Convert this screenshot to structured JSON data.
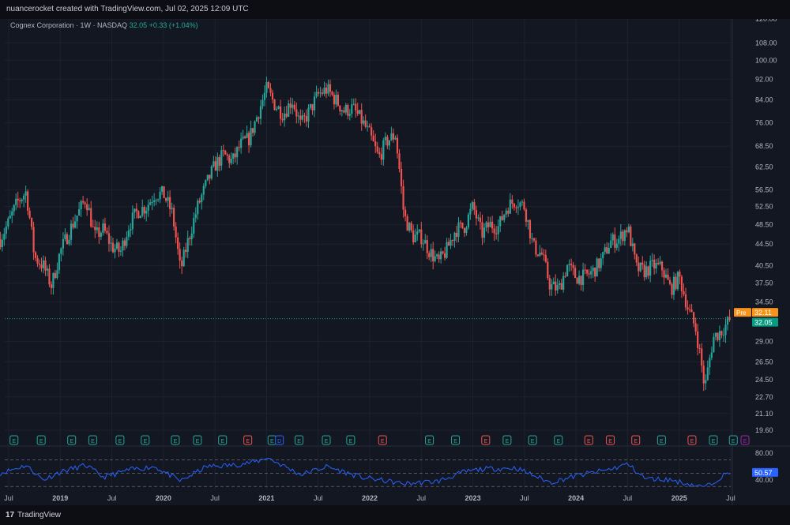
{
  "attribution": "nuancerocket created with TradingView.com, Jul 02, 2025 12:09 UTC",
  "legend": {
    "symbol": "Cognex Corporation · 1W · NASDAQ",
    "price": "32.05",
    "change": "+0.33 (+1.04%)"
  },
  "branding": "TradingView",
  "colors": {
    "up": "#26a69a",
    "down": "#ef5350",
    "rsi": "#2962ff",
    "pre": "#f7931a",
    "last": "#089981",
    "background": "#131722"
  },
  "chart_data": [
    {
      "type": "candlestick",
      "scale": "log",
      "y_ticks": [
        120.0,
        108.0,
        100.0,
        92.0,
        84.0,
        76.0,
        68.5,
        62.5,
        56.5,
        52.5,
        48.5,
        44.5,
        40.5,
        37.5,
        34.5,
        32.11,
        32.05,
        29.0,
        26.5,
        24.5,
        22.7,
        21.1,
        19.6
      ],
      "y_tick_labels": [
        "120.00",
        "108.00",
        "100.00",
        "92.00",
        "84.00",
        "76.00",
        "68.50",
        "62.50",
        "56.50",
        "52.50",
        "48.50",
        "44.50",
        "40.50",
        "37.50",
        "34.50",
        "32.11",
        "32.05",
        "29.00",
        "26.50",
        "24.50",
        "22.70",
        "21.10",
        "19.60"
      ],
      "x_tick_labels": [
        "Jul",
        "2019",
        "Jul",
        "2020",
        "Jul",
        "2021",
        "Jul",
        "2022",
        "Jul",
        "2023",
        "Jul",
        "2024",
        "Jul",
        "2025",
        "Jul"
      ],
      "x_tick_dates": [
        "2018-07-01",
        "2019-01-01",
        "2019-07-01",
        "2020-01-01",
        "2020-07-01",
        "2021-01-01",
        "2021-07-01",
        "2022-01-01",
        "2022-07-01",
        "2023-01-01",
        "2023-07-01",
        "2024-01-01",
        "2024-07-01",
        "2025-01-01",
        "2025-07-01"
      ],
      "last_price": 32.05,
      "pre_market": {
        "label": "Pre",
        "value": "32.11"
      },
      "last_label": "32.05",
      "price_path": [
        [
          "2018-06-01",
          45.5
        ],
        [
          "2018-07-01",
          49.0
        ],
        [
          "2018-08-01",
          53.5
        ],
        [
          "2018-09-01",
          56.0
        ],
        [
          "2018-10-01",
          42.0
        ],
        [
          "2018-11-01",
          40.5
        ],
        [
          "2018-12-01",
          37.0
        ],
        [
          "2019-01-01",
          43.0
        ],
        [
          "2019-02-01",
          47.0
        ],
        [
          "2019-03-01",
          50.5
        ],
        [
          "2019-04-01",
          54.5
        ],
        [
          "2019-05-01",
          46.0
        ],
        [
          "2019-06-01",
          47.5
        ],
        [
          "2019-07-01",
          44.0
        ],
        [
          "2019-08-01",
          43.0
        ],
        [
          "2019-09-01",
          48.5
        ],
        [
          "2019-10-01",
          51.5
        ],
        [
          "2019-11-01",
          52.5
        ],
        [
          "2019-12-01",
          55.5
        ],
        [
          "2020-01-01",
          55.5
        ],
        [
          "2020-02-01",
          51.0
        ],
        [
          "2020-03-01",
          39.5
        ],
        [
          "2020-04-01",
          46.0
        ],
        [
          "2020-05-01",
          52.5
        ],
        [
          "2020-06-01",
          58.0
        ],
        [
          "2020-07-01",
          63.0
        ],
        [
          "2020-08-01",
          66.0
        ],
        [
          "2020-09-01",
          64.0
        ],
        [
          "2020-10-01",
          69.0
        ],
        [
          "2020-11-01",
          71.0
        ],
        [
          "2020-12-01",
          79.0
        ],
        [
          "2021-01-01",
          88.0
        ],
        [
          "2021-02-01",
          82.0
        ],
        [
          "2021-03-01",
          79.0
        ],
        [
          "2021-04-01",
          84.0
        ],
        [
          "2021-05-01",
          75.0
        ],
        [
          "2021-06-01",
          80.0
        ],
        [
          "2021-07-01",
          86.0
        ],
        [
          "2021-08-01",
          88.0
        ],
        [
          "2021-09-01",
          84.0
        ],
        [
          "2021-10-01",
          80.0
        ],
        [
          "2021-11-01",
          81.0
        ],
        [
          "2021-12-01",
          77.0
        ],
        [
          "2022-01-01",
          72.0
        ],
        [
          "2022-02-01",
          65.0
        ],
        [
          "2022-03-01",
          70.0
        ],
        [
          "2022-04-01",
          72.0
        ],
        [
          "2022-05-01",
          50.5
        ],
        [
          "2022-06-01",
          46.0
        ],
        [
          "2022-07-01",
          46.0
        ],
        [
          "2022-08-01",
          43.0
        ],
        [
          "2022-09-01",
          41.0
        ],
        [
          "2022-10-01",
          43.5
        ],
        [
          "2022-11-01",
          47.5
        ],
        [
          "2022-12-01",
          48.0
        ],
        [
          "2023-01-01",
          52.5
        ],
        [
          "2023-02-01",
          46.5
        ],
        [
          "2023-03-01",
          48.5
        ],
        [
          "2023-04-01",
          48.0
        ],
        [
          "2023-05-01",
          52.5
        ],
        [
          "2023-06-01",
          54.0
        ],
        [
          "2023-07-01",
          52.5
        ],
        [
          "2023-08-01",
          44.0
        ],
        [
          "2023-09-01",
          42.5
        ],
        [
          "2023-10-01",
          37.0
        ],
        [
          "2023-11-01",
          36.5
        ],
        [
          "2023-12-01",
          40.5
        ],
        [
          "2024-01-01",
          38.5
        ],
        [
          "2024-02-01",
          38.5
        ],
        [
          "2024-03-01",
          39.5
        ],
        [
          "2024-04-01",
          41.5
        ],
        [
          "2024-05-01",
          45.0
        ],
        [
          "2024-06-01",
          45.5
        ],
        [
          "2024-07-01",
          48.0
        ],
        [
          "2024-08-01",
          40.0
        ],
        [
          "2024-09-01",
          39.5
        ],
        [
          "2024-10-01",
          40.5
        ],
        [
          "2024-11-01",
          40.0
        ],
        [
          "2024-12-01",
          36.5
        ],
        [
          "2025-01-01",
          38.5
        ],
        [
          "2025-02-01",
          33.5
        ],
        [
          "2025-03-01",
          30.5
        ],
        [
          "2025-04-01",
          23.5
        ],
        [
          "2025-05-01",
          29.5
        ],
        [
          "2025-06-01",
          30.5
        ],
        [
          "2025-07-01",
          32.05
        ]
      ]
    },
    {
      "type": "line",
      "name": "RSI",
      "y_ticks": [
        80.0,
        40.0
      ],
      "y_tick_labels": [
        "80.00",
        "40.00"
      ],
      "bands": [
        70,
        50,
        30
      ],
      "last_value": "50.57",
      "rsi_path": [
        [
          "2018-06-01",
          50
        ],
        [
          "2018-09-01",
          62
        ],
        [
          "2018-11-01",
          40
        ],
        [
          "2019-01-01",
          52
        ],
        [
          "2019-04-01",
          62
        ],
        [
          "2019-06-01",
          44
        ],
        [
          "2019-09-01",
          55
        ],
        [
          "2019-12-01",
          60
        ],
        [
          "2020-03-01",
          38
        ],
        [
          "2020-06-01",
          60
        ],
        [
          "2020-09-01",
          62
        ],
        [
          "2020-12-01",
          68
        ],
        [
          "2021-01-01",
          74
        ],
        [
          "2021-05-01",
          48
        ],
        [
          "2021-08-01",
          60
        ],
        [
          "2021-12-01",
          44
        ],
        [
          "2022-02-01",
          40
        ],
        [
          "2022-05-01",
          34
        ],
        [
          "2022-09-01",
          38
        ],
        [
          "2022-12-01",
          52
        ],
        [
          "2023-02-01",
          56
        ],
        [
          "2023-06-01",
          58
        ],
        [
          "2023-10-01",
          36
        ],
        [
          "2024-01-01",
          46
        ],
        [
          "2024-05-01",
          56
        ],
        [
          "2024-07-01",
          64
        ],
        [
          "2024-09-01",
          42
        ],
        [
          "2024-12-01",
          40
        ],
        [
          "2025-02-01",
          34
        ],
        [
          "2025-04-01",
          28
        ],
        [
          "2025-06-01",
          46
        ],
        [
          "2025-07-01",
          50.57
        ]
      ]
    }
  ],
  "events": {
    "items": [
      {
        "date": "2018-07-20",
        "t": "E",
        "c": "e"
      },
      {
        "date": "2018-10-25",
        "t": "E",
        "c": "e"
      },
      {
        "date": "2019-02-10",
        "t": "E",
        "c": "e"
      },
      {
        "date": "2019-04-25",
        "t": "E",
        "c": "e"
      },
      {
        "date": "2019-07-30",
        "t": "E",
        "c": "e"
      },
      {
        "date": "2019-10-28",
        "t": "E",
        "c": "e"
      },
      {
        "date": "2020-02-12",
        "t": "E",
        "c": "e"
      },
      {
        "date": "2020-04-30",
        "t": "E",
        "c": "e"
      },
      {
        "date": "2020-07-28",
        "t": "E",
        "c": "e"
      },
      {
        "date": "2020-10-26",
        "t": "E",
        "c": "x"
      },
      {
        "date": "2021-01-20",
        "t": "E",
        "c": "e"
      },
      {
        "date": "2021-02-15",
        "t": "D",
        "c": "d"
      },
      {
        "date": "2021-04-25",
        "t": "E",
        "c": "e"
      },
      {
        "date": "2021-07-30",
        "t": "E",
        "c": "e"
      },
      {
        "date": "2021-10-25",
        "t": "E",
        "c": "e"
      },
      {
        "date": "2022-02-15",
        "t": "E",
        "c": "x"
      },
      {
        "date": "2022-07-30",
        "t": "E",
        "c": "e"
      },
      {
        "date": "2022-10-31",
        "t": "E",
        "c": "e"
      },
      {
        "date": "2023-02-15",
        "t": "E",
        "c": "x"
      },
      {
        "date": "2023-05-01",
        "t": "E",
        "c": "e"
      },
      {
        "date": "2023-07-30",
        "t": "E",
        "c": "e"
      },
      {
        "date": "2023-10-30",
        "t": "E",
        "c": "e"
      },
      {
        "date": "2024-02-15",
        "t": "E",
        "c": "x"
      },
      {
        "date": "2024-05-01",
        "t": "E",
        "c": "x"
      },
      {
        "date": "2024-07-30",
        "t": "E",
        "c": "x"
      },
      {
        "date": "2024-10-30",
        "t": "E",
        "c": "e"
      },
      {
        "date": "2025-02-15",
        "t": "E",
        "c": "x"
      },
      {
        "date": "2025-05-01",
        "t": "E",
        "c": "e"
      },
      {
        "date": "2025-07-10",
        "t": "E",
        "c": "e"
      },
      {
        "date": "2025-08-20",
        "t": "E",
        "c": "m"
      }
    ]
  }
}
